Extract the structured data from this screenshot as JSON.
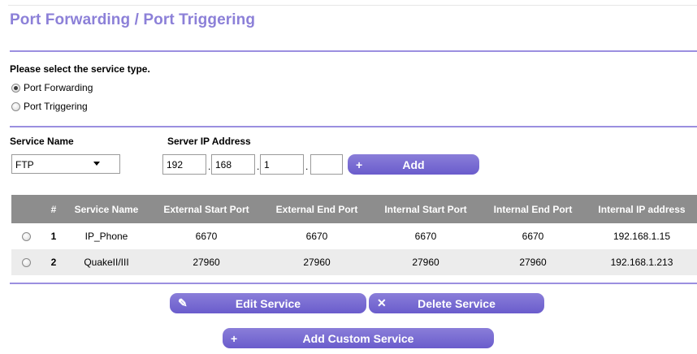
{
  "page": {
    "title": "Port Forwarding / Port Triggering"
  },
  "service_type": {
    "prompt": "Please select the service type.",
    "options": [
      {
        "label": "Port Forwarding",
        "selected": true
      },
      {
        "label": "Port Triggering",
        "selected": false
      }
    ]
  },
  "form": {
    "service_name_label": "Service Name",
    "service_name_value": "FTP",
    "server_ip_label": "Server IP Address",
    "ip_octets": [
      "192",
      "168",
      "1",
      ""
    ],
    "add_button": {
      "icon": "plus-icon",
      "label": "Add"
    }
  },
  "table": {
    "headers": [
      "#",
      "Service Name",
      "External Start Port",
      "External End Port",
      "Internal Start Port",
      "Internal End Port",
      "Internal IP address"
    ],
    "rows": [
      {
        "num": "1",
        "service": "IP_Phone",
        "ext_start": "6670",
        "ext_end": "6670",
        "int_start": "6670",
        "int_end": "6670",
        "ip": "192.168.1.15"
      },
      {
        "num": "2",
        "service": "QuakeII/III",
        "ext_start": "27960",
        "ext_end": "27960",
        "int_start": "27960",
        "int_end": "27960",
        "ip": "192.168.1.213"
      }
    ]
  },
  "actions": {
    "edit": {
      "icon": "pencil-icon",
      "label": "Edit Service"
    },
    "delete": {
      "icon": "close-icon",
      "label": "Delete Service"
    },
    "add_custom": {
      "icon": "plus-icon",
      "label": "Add Custom Service"
    }
  },
  "colors": {
    "accent": "#8c80d8",
    "button": "#7466d2",
    "table_header": "#8d8d8d",
    "row_alt": "#ececec"
  }
}
